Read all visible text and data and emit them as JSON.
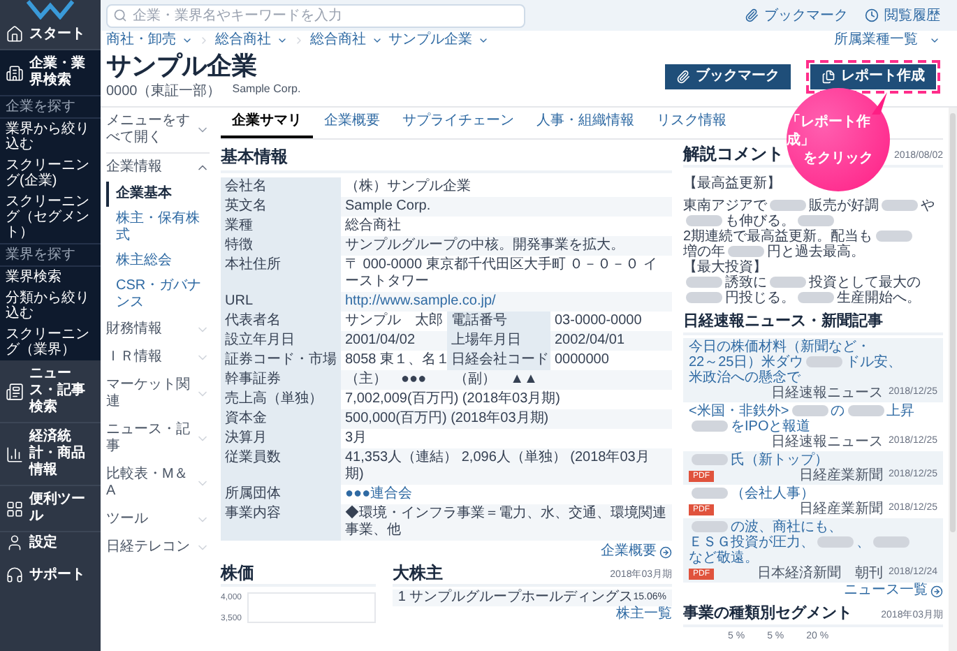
{
  "sidebar": {
    "items": [
      {
        "label": "スタート",
        "selected": false
      },
      {
        "label": "企業・業界検索",
        "selected": true,
        "groups": [
          {
            "heading": "企業を探す",
            "items": [
              "業界から絞り込む",
              "スクリーニング(企業)",
              "スクリーニング（セグメント）"
            ]
          },
          {
            "heading": "業界を探す",
            "items": [
              "業界検索",
              "分類から絞り込む",
              "スクリーニング（業界）"
            ]
          }
        ]
      },
      {
        "label": "ニュース・記事検索",
        "selected": false
      },
      {
        "label": "経済統計・商品情報",
        "selected": false
      },
      {
        "label": "便利ツール",
        "selected": false
      }
    ],
    "bottom": [
      "設定",
      "サポート"
    ]
  },
  "search": {
    "placeholder": "企業・業界名やキーワードを入力"
  },
  "header_links": [
    "ブックマーク",
    "閲覧履歴"
  ],
  "breadcrumb": [
    "商社・卸売",
    "総合商社",
    "総合商社",
    "サンプル企業"
  ],
  "breadcrumb_right": "所属業種一覧",
  "company": {
    "name": "サンプル企業",
    "code": "0000（東証一部）",
    "english": "Sample Corp."
  },
  "actions": [
    {
      "label": "ブックマーク",
      "highlighted": false
    },
    {
      "label": "レポート作成",
      "highlighted": true
    }
  ],
  "callout": {
    "lines": [
      "「レポート作成」",
      "をクリック"
    ]
  },
  "menu": {
    "expand_all": "メニューをすべて開く",
    "sections": [
      {
        "label": "企業情報",
        "expanded": true,
        "children": [
          {
            "label": "企業基本",
            "selected": true
          },
          {
            "label": "株主・保有株式",
            "selected": false
          },
          {
            "label": "株主総会",
            "selected": false
          },
          {
            "label": "CSR・ガバナンス",
            "selected": false
          }
        ]
      },
      {
        "label": "財務情報",
        "expanded": false
      },
      {
        "label": "ＩＲ情報",
        "expanded": false
      },
      {
        "label": "マーケット関連",
        "expanded": false
      },
      {
        "label": "ニュース・記事",
        "expanded": false
      },
      {
        "label": "比較表・M＆A",
        "expanded": false
      },
      {
        "label": "ツール",
        "expanded": false
      },
      {
        "label": "日経テレコン",
        "expanded": false
      }
    ]
  },
  "tabs": [
    {
      "label": "企業サマリ",
      "selected": true
    },
    {
      "label": "企業概要",
      "selected": false
    },
    {
      "label": "サプライチェーン",
      "selected": false
    },
    {
      "label": "人事・組織情報",
      "selected": false
    },
    {
      "label": "リスク情報",
      "selected": false
    }
  ],
  "basic_info": {
    "title": "基本情報",
    "link": "企業概要",
    "rows": [
      [
        {
          "label": "会社名",
          "value": "（株）サンプル企業"
        }
      ],
      [
        {
          "label": "英文名",
          "value": "Sample Corp."
        }
      ],
      [
        {
          "label": "業種",
          "value": "総合商社"
        }
      ],
      [
        {
          "label": "特徴",
          "value": "サンプルグループの中核。開発事業を拡大。"
        }
      ],
      [
        {
          "label": "本社住所",
          "value": "〒 000-0000 東京都千代田区大手町 ０－０－０ イーストタワー"
        }
      ],
      [
        {
          "label": "URL",
          "value": "http://www.sample.co.jp/",
          "kind": "link"
        }
      ],
      [
        {
          "label": "代表者名",
          "value": "サンプル　太郎"
        },
        {
          "label": "電話番号",
          "value": "03-0000-0000"
        }
      ],
      [
        {
          "label": "設立年月日",
          "value": "2001/04/02"
        },
        {
          "label": "上場年月日",
          "value": "2002/04/01"
        }
      ],
      [
        {
          "label": "証券コード・市場",
          "value": "8058 東１、名１"
        },
        {
          "label": "日経会社コード",
          "value": "0000000"
        }
      ],
      [
        {
          "label": "幹事証券",
          "value": "（主）　●●●　　（副）　▲▲"
        }
      ],
      [
        {
          "label": "売上高（単独）",
          "value": "7,002,009(百万円) (2018年03月期)"
        }
      ],
      [
        {
          "label": "資本金",
          "value": "500,000(百万円) (2018年03月期)"
        }
      ],
      [
        {
          "label": "決算月",
          "value": "3月"
        }
      ],
      [
        {
          "label": "従業員数",
          "value": "41,353人（連結） 2,096人（単独） (2018年03月期)"
        }
      ],
      [
        {
          "label": "所属団体",
          "value": "●●●連合会",
          "kind": "link"
        }
      ],
      [
        {
          "label": "事業内容",
          "value": "◆環境・インフラ事業＝電力、水、交通、環境関連事業、他"
        }
      ]
    ]
  },
  "comment": {
    "title": "解説コメント",
    "date": "2018/08/02",
    "paragraphs": [
      [
        {
          "kind": "text",
          "text": "【最高益更新】"
        }
      ],
      [
        {
          "kind": "text",
          "text": "東南アジアで"
        },
        {
          "kind": "blur"
        },
        {
          "kind": "text",
          "text": "販売が好調"
        },
        {
          "kind": "blur"
        },
        {
          "kind": "text",
          "text": "や"
        },
        {
          "kind": "blur"
        },
        {
          "kind": "text",
          "text": "も伸びる。"
        },
        {
          "kind": "blur"
        },
        {
          "kind": "text",
          "text": "2期連続で最高益更新。"
        },
        {
          "kind": "text",
          "text": "配当も"
        },
        {
          "kind": "blur"
        },
        {
          "kind": "text",
          "text": "増の年"
        },
        {
          "kind": "blur"
        },
        {
          "kind": "text",
          "text": "円と過去最高。"
        }
      ],
      [
        {
          "kind": "text",
          "text": "【最大投資】"
        }
      ],
      [
        {
          "kind": "blur"
        },
        {
          "kind": "text",
          "text": "誘致に"
        },
        {
          "kind": "blur"
        },
        {
          "kind": "text",
          "text": "投資として最大の"
        },
        {
          "kind": "blur"
        },
        {
          "kind": "text",
          "text": "円投じる。"
        },
        {
          "kind": "blur"
        },
        {
          "kind": "text",
          "text": "生産開始へ。"
        }
      ]
    ]
  },
  "news": {
    "title": "日経速報ニュース・新聞記事",
    "more": "ニュース一覧",
    "items": [
      {
        "parts": [
          {
            "kind": "text",
            "text": "今日の株価材料（新聞など・"
          },
          {
            "kind": "text",
            "text": "22～25日）米ダウ"
          },
          {
            "kind": "blur"
          },
          {
            "kind": "text",
            "text": "ドル安、"
          },
          {
            "kind": "text",
            "text": "米政治への懸念で"
          }
        ],
        "source": "日経速報ニュース",
        "date": "2018/12/25"
      },
      {
        "parts": [
          {
            "kind": "text",
            "text": "<米国・非鉄外>"
          },
          {
            "kind": "blur"
          },
          {
            "kind": "text",
            "text": "の"
          },
          {
            "kind": "blur"
          },
          {
            "kind": "text",
            "text": "上昇"
          },
          {
            "kind": "blur"
          },
          {
            "kind": "text",
            "text": "をIPOと報道"
          }
        ],
        "source": "日経速報ニュース",
        "date": "2018/12/25"
      },
      {
        "parts": [
          {
            "kind": "blur"
          },
          {
            "kind": "text",
            "text": "氏（新トップ）"
          }
        ],
        "badge": "PDF",
        "source": "日経産業新聞",
        "date": "2018/12/25"
      },
      {
        "parts": [
          {
            "kind": "blur"
          },
          {
            "kind": "text",
            "text": "（会社人事）"
          }
        ],
        "badge": "PDF",
        "source": "日経産業新聞",
        "date": "2018/12/25"
      },
      {
        "parts": [
          {
            "kind": "blur"
          },
          {
            "kind": "text",
            "text": "の波、商社にも、"
          },
          {
            "kind": "text",
            "text": "ＥＳＧ投資が圧力、"
          },
          {
            "kind": "blur"
          },
          {
            "kind": "text",
            "text": "、"
          },
          {
            "kind": "blur"
          },
          {
            "kind": "text",
            "text": "など敬遠。"
          }
        ],
        "badge": "PDF",
        "source": "日本経済新聞　朝刊",
        "date": "2018/12/24"
      }
    ]
  },
  "stock": {
    "title": "株価",
    "yticks": [
      "4,000",
      "3,500"
    ]
  },
  "shareholders": {
    "title": "大株主",
    "date": "2018年03月期",
    "rows": [
      {
        "name": "1 サンプルグループホールディングス",
        "value": "15.06%"
      }
    ],
    "more": "株主一覧"
  },
  "segments": {
    "title": "事業の種類別セグメント",
    "date": "2018年03月期",
    "labels": [
      "5 %",
      "5 %",
      "20 %"
    ]
  }
}
